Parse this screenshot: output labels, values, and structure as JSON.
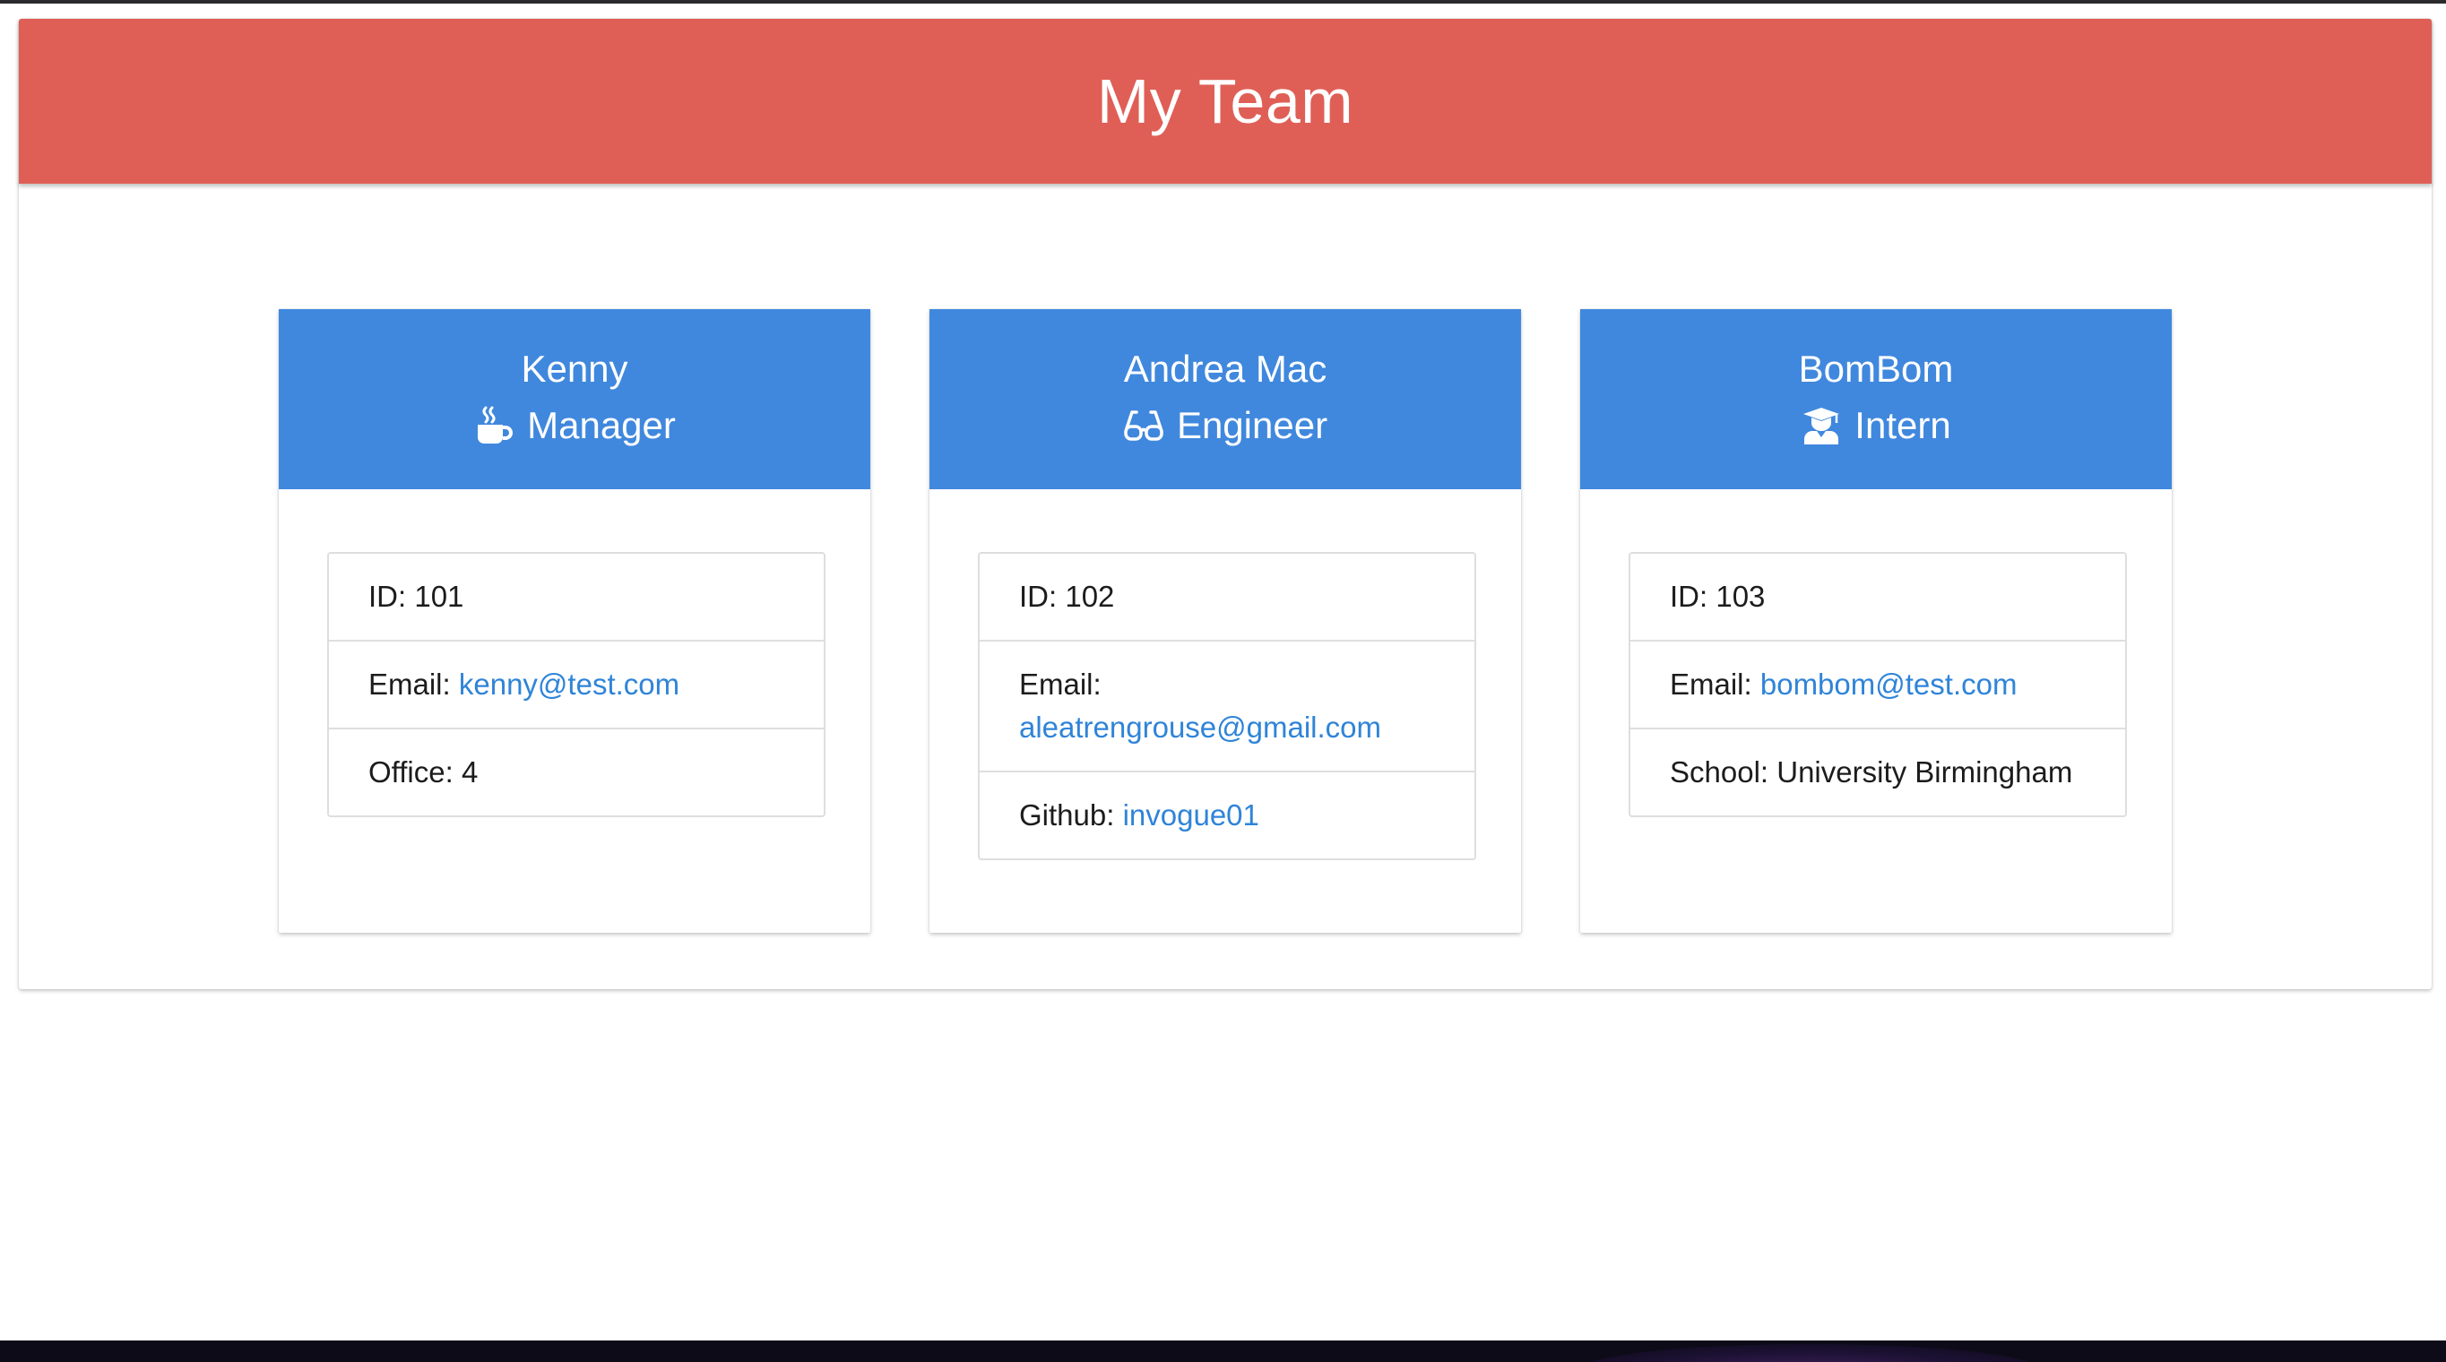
{
  "page": {
    "title": "My Team"
  },
  "colors": {
    "header_bg": "#df5f56",
    "card_header_bg": "#4088dd",
    "link": "#2f84d8"
  },
  "team": [
    {
      "name": "Kenny",
      "role": "Manager",
      "role_icon": "coffee-mug-icon",
      "id_label": "ID:",
      "id": "101",
      "email_label": "Email:",
      "email": "kenny@test.com",
      "extra_label": "Office:",
      "extra_value": "4"
    },
    {
      "name": "Andrea Mac",
      "role": "Engineer",
      "role_icon": "glasses-icon",
      "id_label": "ID:",
      "id": "102",
      "email_label": "Email:",
      "email": "aleatrengrouse@gmail.com",
      "extra_label": "Github:",
      "extra_value": "invogue01"
    },
    {
      "name": "BomBom",
      "role": "Intern",
      "role_icon": "graduate-icon",
      "id_label": "ID:",
      "id": "103",
      "email_label": "Email:",
      "email": "bombom@test.com",
      "extra_label": "School:",
      "extra_value": "University Birmingham"
    }
  ]
}
